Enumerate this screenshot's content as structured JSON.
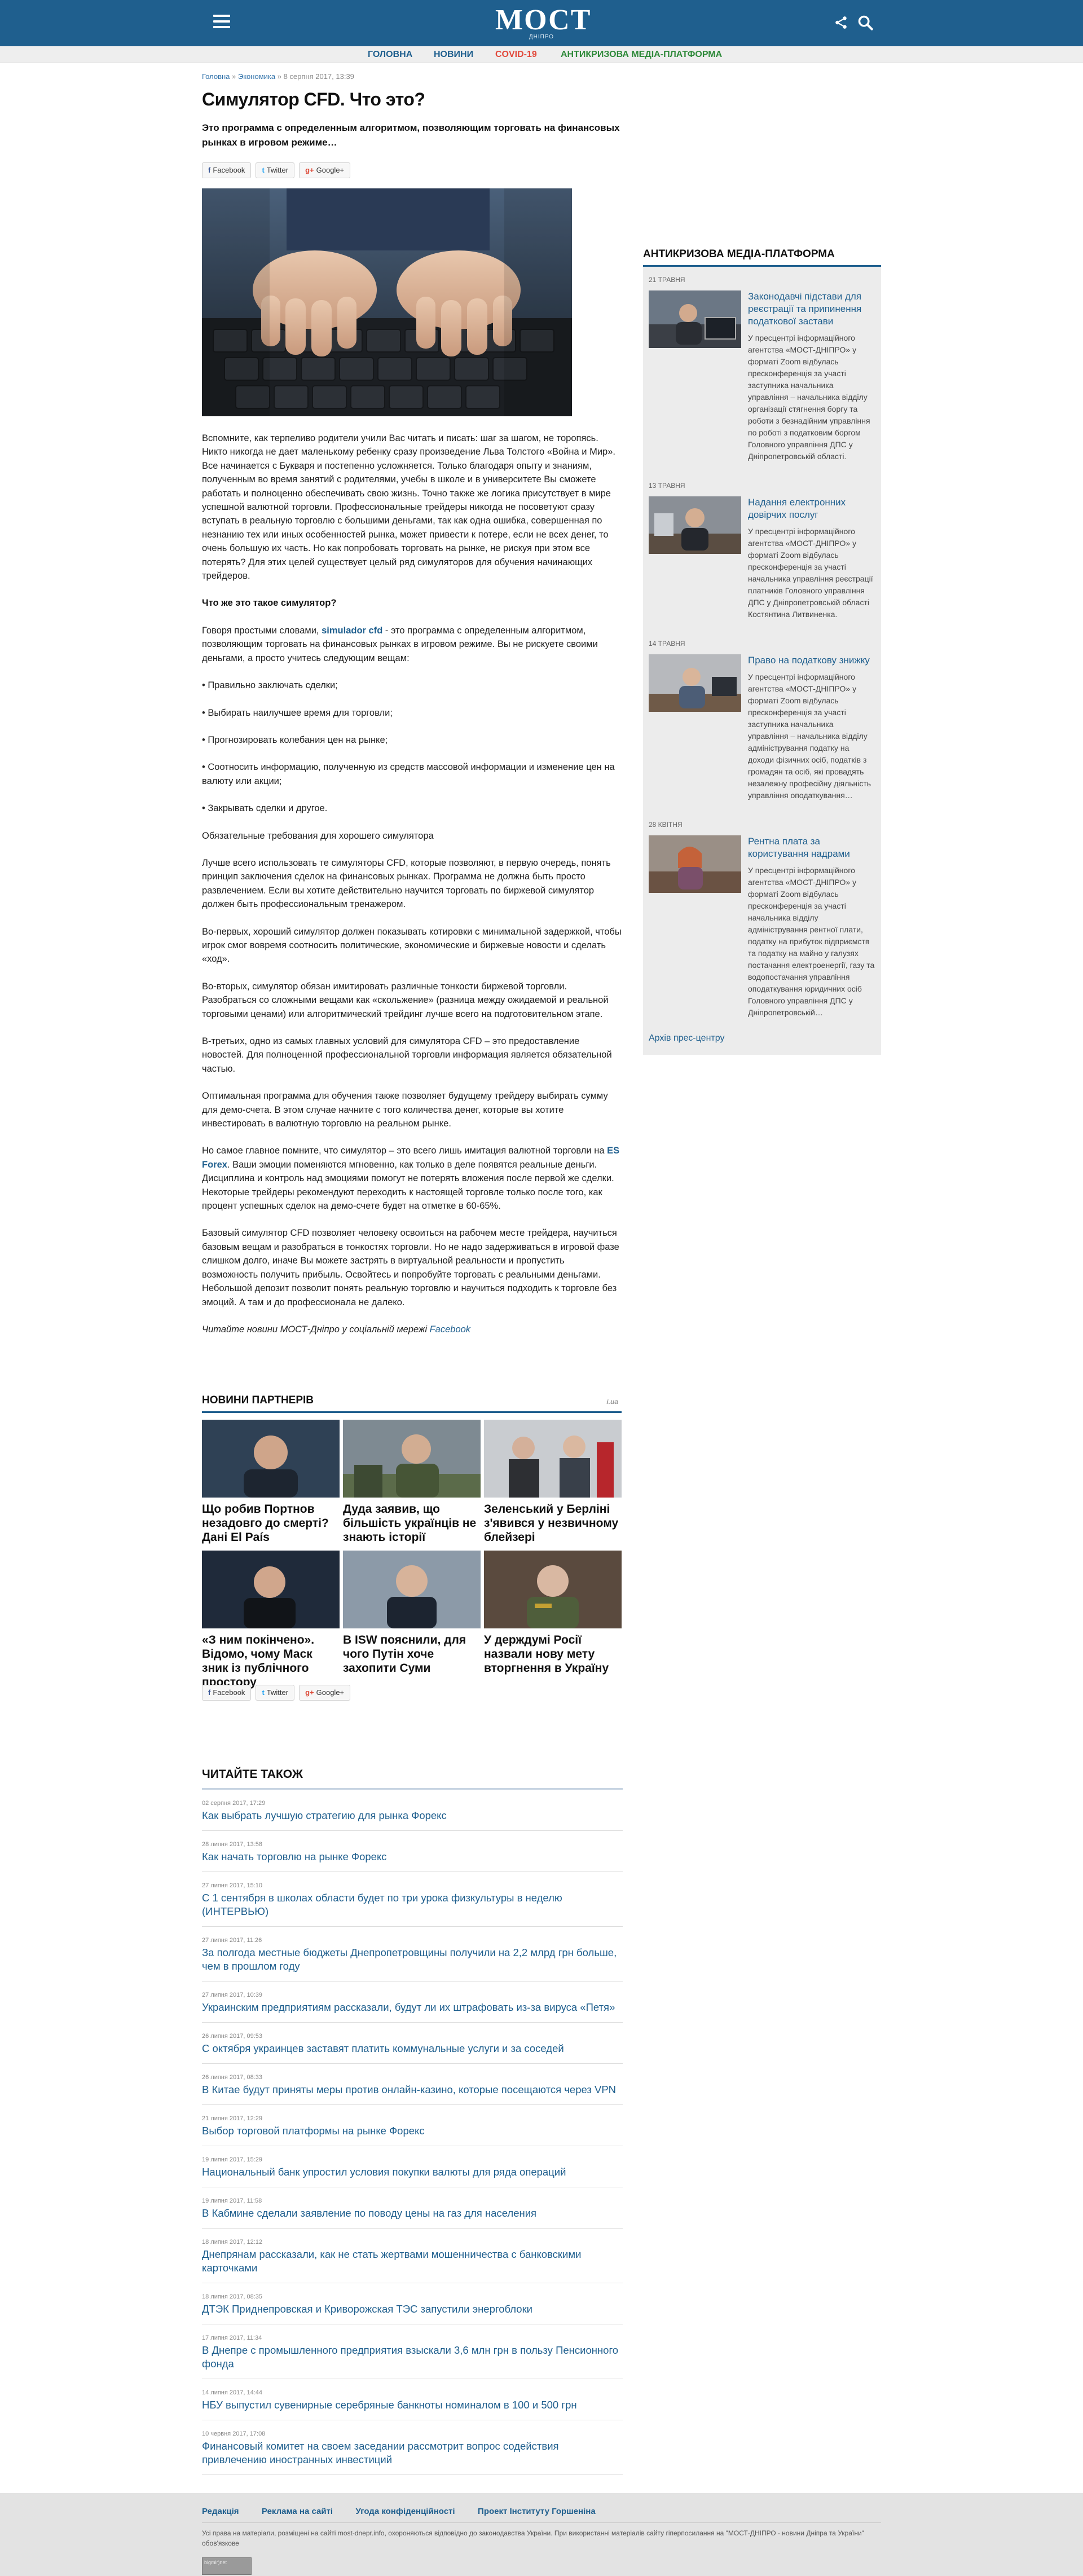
{
  "header": {
    "logo": "МОСТ",
    "logo_sub": "ДНІПРО",
    "colors": {
      "brand": "#1f5f8e",
      "covid": "#e24a3c",
      "antikriz": "#2f8a3a"
    }
  },
  "nav": [
    {
      "label": "ГОЛОВНА"
    },
    {
      "label": "НОВИНИ"
    },
    {
      "label": "COVID-19"
    },
    {
      "label": "АНТИКРИЗОВА МЕДІА-ПЛАТФОРМА"
    }
  ],
  "breadcrumb": {
    "home": "Головна",
    "sep1": " » ",
    "section": "Экономика",
    "sep2": " » ",
    "date": "8 серпня 2017, 13:39"
  },
  "article": {
    "title": "Симулятор CFD. Что это?",
    "lead": "Это программа с определенным алгоритмом, позволяющим торговать на финансовых рынках в игровом режиме…",
    "share": {
      "facebook": "Facebook",
      "twitter": "Twitter",
      "google": "Google+"
    },
    "p1": "Вспомните, как терпеливо родители учили Вас читать и писать: шаг за шагом, не торопясь. Никто никогда не дает маленькому ребенку сразу произведение Льва Толстого «Война и Мир». Все начинается с Букваря и постепенно усложняется. Только благодаря опыту и знаниям, полученным во время занятий с родителями, учебы в школе и в университете Вы сможете работать и полноценно обеспечивать свою жизнь. Точно также же логика присутствует в мире успешной валютной торговли. Профессиональные трейдеры никогда не посоветуют сразу вступать в реальную торговлю с большими деньгами, так как одна ошибка, совершенная по незнанию тех или иных особенностей рынка, может привести к потере, если не всех денег, то очень большую их часть. Но как попробовать торговать на рынке, не рискуя при этом все потерять? Для этих целей существует целый ряд симуляторов для обучения начинающих трейдеров.",
    "h1": "Что же это такое симулятор?",
    "p2_pre": "Говоря простыми словами, ",
    "p2_link": "simulador cfd",
    "p2_post": " - это программа с определенным алгоритмом, позволяющим торговать на финансовых рынках в игровом режиме. Вы не рискуете своими деньгами, а просто учитесь следующим вещам:",
    "b1": "• Правильно заключать сделки;",
    "b2": "• Выбирать наилучшее время для торговли;",
    "b3": "• Прогнозировать колебания цен на рынке;",
    "b4": "• Соотносить информацию, полученную из средств массовой информации и изменение цен на валюту или акции;",
    "b5": "• Закрывать сделки и другое.",
    "p3": "Обязательные требования для хорошего симулятора",
    "p4": "Лучше всего использовать те симуляторы CFD, которые позволяют, в первую очередь, понять принцип заключения сделок на финансовых рынках. Программа не должна быть просто развлечением. Если вы хотите действительно научится торговать по биржевой симулятор должен быть профессиональным тренажером.",
    "p5": "Во-первых, хороший симулятор должен показывать котировки с минимальной задержкой, чтобы игрок смог вовремя соотносить политические, экономические и биржевые новости и сделать «ход».",
    "p6": "Во-вторых, симулятор обязан имитировать различные тонкости биржевой торговли. Разобраться со сложными вещами как «скольжение» (разница между ожидаемой и реальной торговыми ценами) или алгоритмический трейдинг лучше всего на подготовительном этапе.",
    "p7": "В-третьих, одно из самых главных условий для симулятора CFD – это предоставление новостей. Для полноценной профессиональной торговли информация является обязательной частью.",
    "p8": "Оптимальная программа для обучения также позволяет будущему трейдеру выбирать сумму для демо-счета. В этом случае начните с того количества денег, которые вы хотите инвестировать в валютную торговлю на реальном рынке.",
    "p9_pre": "Но самое главное помните, что симулятор – это всего лишь имитация валютной торговли на ",
    "p9_link": "ES Forex",
    "p9_post": ". Ваши эмоции поменяются мгновенно, как только в деле появятся реальные деньги. Дисциплина и контроль над эмоциями помогут не потерять вложения после первой же сделки. Некоторые трейдеры рекомендуют переходить к настоящей торговле только после того, как процент успешных сделок на демо-счете будет на отметке в 60-65%.",
    "p10": "Базовый симулятор CFD позволяет человеку освоиться на рабочем месте трейдера, научиться базовым вещам и разобраться в тонкостях торговли. Но не надо задерживаться в игровой фазе слишком долго, иначе Вы можете застрять в виртуальной реальности и пропустить возможность получить прибыль. Освойтесь и попробуйте торговать с реальными деньгами. Небольшой депозит позволит понять реальную торговлю и научиться подходить к торговле без эмоций. А там и до профессионала не далеко.",
    "signoff_pre": "Читайте новини МОСТ-Дніпро у соціальній мережі ",
    "signoff_link": "Facebook"
  },
  "sidebar": {
    "heading": "АНТИКРИЗОВА МЕДІА-ПЛАТФОРМА",
    "items": [
      {
        "date": "21 ТРАВНЯ",
        "title": "Законодавчі підстави для реєстрації та припинення податкової застави",
        "text": "У пресцентрі інформаційного агентства «МОСТ-ДНІПРО» у форматі Zoom відбулась пресконференція за участі заступника начальника управління – начальника відділу організації стягнення боргу та роботи з безнадійним управління по роботі з податковим боргом Головного управління ДПС у Дніпропетровській області."
      },
      {
        "date": "13 ТРАВНЯ",
        "title": "Надання електронних довірчих послуг",
        "text": "У пресцентрі інформаційного агентства «МОСТ-ДНІПРО» у форматі Zoom відбулась пресконференція за участі начальника управління реєстрації платників Головного управління ДПС у Дніпропетровській області Костянтина Литвиненка."
      },
      {
        "date": "14 ТРАВНЯ",
        "title": "Право на податкову знижку",
        "text": "У пресцентрі інформаційного агентства «МОСТ-ДНІПРО» у форматі Zoom відбулась пресконференція за участі заступника начальника управління – начальника відділу адміністрування податку на доходи фізичних осіб, податків з громадян та осіб, які провадять незалежну професійну діяльність управління оподаткування…"
      },
      {
        "date": "28 КВІТНЯ",
        "title": "Рентна плата за користування надрами",
        "text": "У пресцентрі інформаційного агентства «МОСТ-ДНІПРО» у форматі Zoom відбулась пресконференція за участі начальника відділу адміністрування рентної плати, податку на прибуток підприємств та податку на майно у галузях постачання електроенергії, газу та водопостачання управління оподаткування юридичних осіб Головного управління ДПС у Дніпропетровській…"
      }
    ],
    "archive": "Архів прес-центру"
  },
  "partners": {
    "heading": "НОВИНИ ПАРТНЕРІВ",
    "logo": "i.ua",
    "items": [
      {
        "title": "Що робив Портнов незадовго до смерті? Дані El País"
      },
      {
        "title": "Дуда заявив, що більшість українців не знають історії"
      },
      {
        "title": "Зеленський у Берліні з'явився у незвичному блейзері"
      },
      {
        "title": "«З ним покінчено». Відомо, чому Маск зник із публічного простору"
      },
      {
        "title": "В ISW пояснили, для чого Путін хоче захопити Суми"
      },
      {
        "title": "У держдумі Росії назвали нову мету вторгнення в Україну"
      }
    ]
  },
  "readalso": {
    "heading": "ЧИТАЙТЕ ТАКОЖ",
    "items": [
      {
        "date": "02 серпня 2017, 17:29",
        "title": "Как выбрать лучшую стратегию для рынка Форекс"
      },
      {
        "date": "28 липня 2017, 13:58",
        "title": "Как начать торговлю на рынке Форекс"
      },
      {
        "date": "27 липня 2017, 15:10",
        "title": "С 1 сентября в школах области будет по три урока физкультуры в неделю (ИНТЕРВЬЮ)"
      },
      {
        "date": "27 липня 2017, 11:26",
        "title": "За полгода местные бюджеты Днепропетровщины получили на 2,2 млрд грн больше, чем в прошлом году"
      },
      {
        "date": "27 липня 2017, 10:39",
        "title": "Украинским предприятиям рассказали, будут ли их штрафовать из-за вируса «Петя»"
      },
      {
        "date": "26 липня 2017, 09:53",
        "title": "С октября украинцев заставят платить коммунальные услуги и за соседей"
      },
      {
        "date": "26 липня 2017, 08:33",
        "title": "В Китае будут приняты меры против онлайн-казино, которые посещаются через VPN"
      },
      {
        "date": "21 липня 2017, 12:29",
        "title": "Выбор торговой платформы на рынке Форекс"
      },
      {
        "date": "19 липня 2017, 15:29",
        "title": "Национальный банк упростил условия покупки валюты для ряда операций"
      },
      {
        "date": "19 липня 2017, 11:58",
        "title": "В Кабмине сделали заявление по поводу цены на газ для населения"
      },
      {
        "date": "18 липня 2017, 12:12",
        "title": "Днепрянам рассказали, как не стать жертвами мошенничества с банковскими карточками"
      },
      {
        "date": "18 липня 2017, 08:35",
        "title": "ДТЭК Приднепровская и Криворожская ТЭС запустили энергоблоки"
      },
      {
        "date": "17 липня 2017, 11:34",
        "title": "В Днепре с промышленного предприятия взыскали 3,6 млн грн в пользу Пенсионного фонда"
      },
      {
        "date": "14 липня 2017, 14:44",
        "title": "НБУ выпустил сувенирные серебряные банкноты номиналом в 100 и 500 грн"
      },
      {
        "date": "10 червня 2017, 17:08",
        "title": "Финансовый комитет на своем заседании рассмотрит вопрос содействия привлечению иностранных инвестиций"
      }
    ]
  },
  "footer": {
    "links": [
      "Редакція",
      "Реклама на сайті",
      "Угода конфіденційності",
      "Проект Інституту Горшеніна"
    ],
    "copyright": "Усі права на матеріали, розміщені на сайті most-dnepr.info, охороняються відповідно до законодавства України. При використанні матеріалів сайту гіперпосилання на \"МОСТ-ДНІПРО - новини Дніпра та України\" обов'язкове",
    "counter": "bigmir)net"
  }
}
